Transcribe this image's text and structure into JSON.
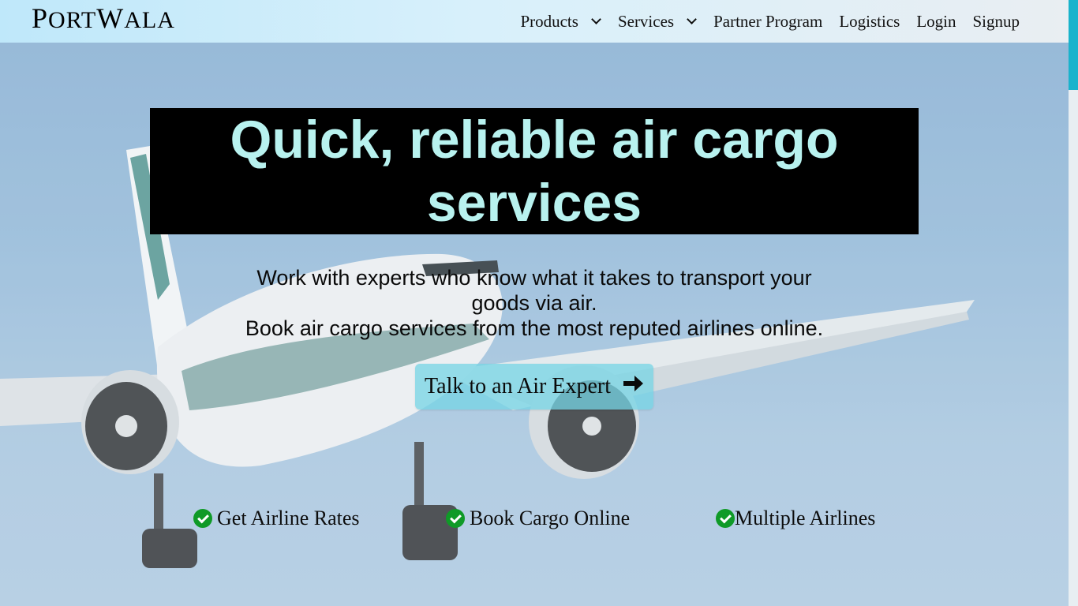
{
  "brand": {
    "logo_first": "P",
    "logo_rest1": "ORT",
    "logo_mid": "W",
    "logo_rest2": "ALA"
  },
  "nav": {
    "products": "Products",
    "services": "Services",
    "partner": "Partner Program",
    "logistics": "Logistics",
    "login": "Login",
    "signup": "Signup"
  },
  "hero": {
    "headline": "Quick, reliable air cargo services",
    "sub_line1": "Work with experts who know what it takes to transport your goods via air.",
    "sub_line2": "Book air cargo services from the most reputed airlines online.",
    "cta_label": "Talk to an Air Expert"
  },
  "features": [
    {
      "label": "Get Airline Rates"
    },
    {
      "label": "Book Cargo Online"
    },
    {
      "label": "Multiple Airlines"
    }
  ],
  "icons": {
    "chevron": "chevron-down-icon",
    "arrow": "arrow-right-icon",
    "check": "check-circle-icon"
  },
  "colors": {
    "accent": "#19b3cc",
    "headline_text": "#b8f2ef",
    "check": "#0f9a27"
  }
}
